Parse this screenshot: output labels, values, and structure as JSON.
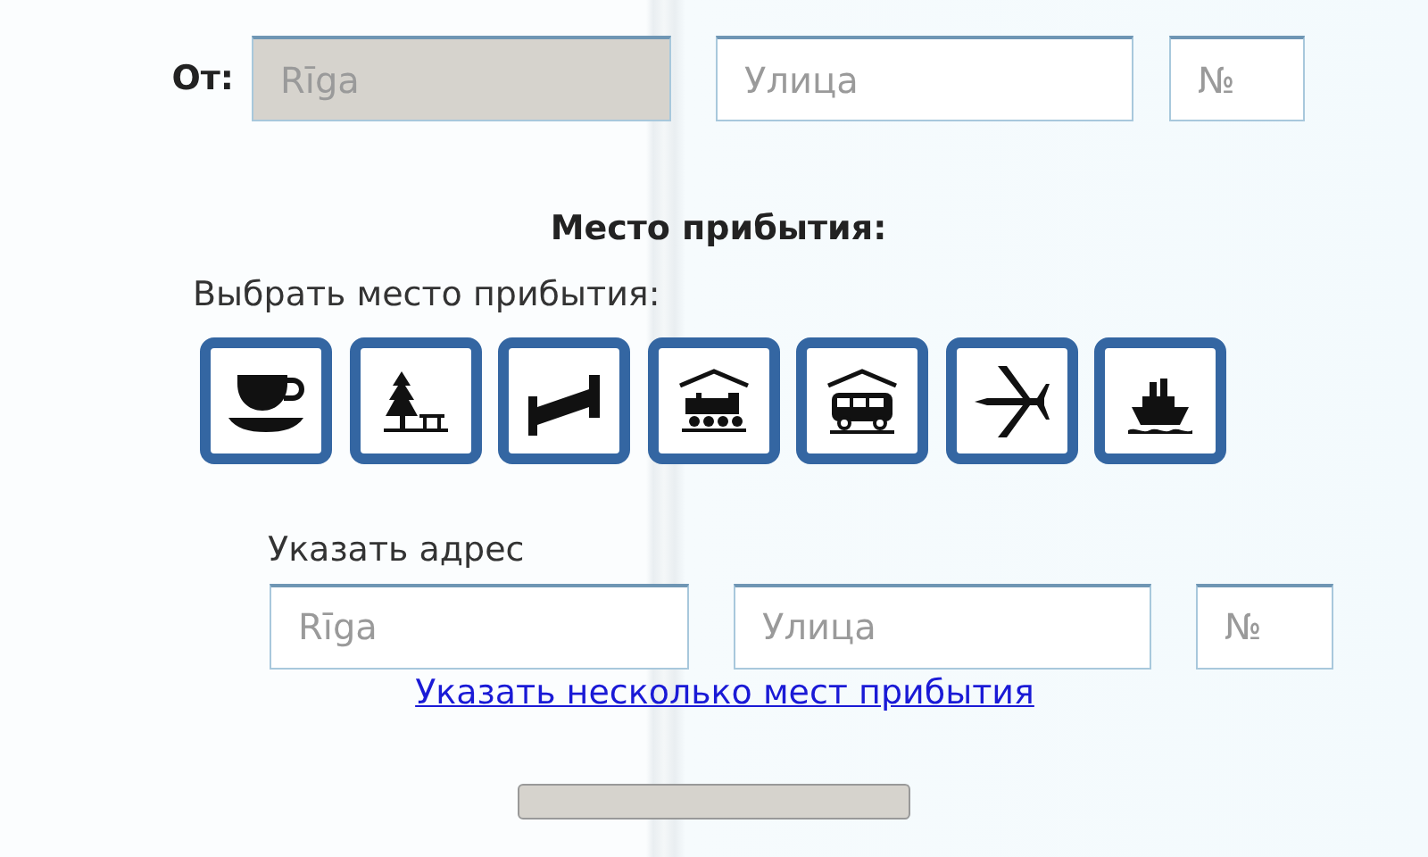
{
  "from": {
    "label": "От:",
    "fields": [
      {
        "kind": "city",
        "value": "Rīga",
        "disabled": true
      },
      {
        "kind": "street",
        "placeholder": "Улица",
        "disabled": false
      },
      {
        "kind": "number",
        "placeholder": "№",
        "disabled": false
      }
    ]
  },
  "arrival": {
    "title": "Место прибытия:",
    "choose_label": "Выбрать место прибытия:",
    "places": [
      {
        "kind": "cafe"
      },
      {
        "kind": "park"
      },
      {
        "kind": "hotel"
      },
      {
        "kind": "train"
      },
      {
        "kind": "bus"
      },
      {
        "kind": "airport"
      },
      {
        "kind": "port"
      }
    ],
    "address_label": "Указать адрес",
    "fields": [
      {
        "kind": "city",
        "placeholder": "Rīga",
        "disabled": false
      },
      {
        "kind": "street",
        "placeholder": "Улица",
        "disabled": false
      },
      {
        "kind": "number",
        "placeholder": "№",
        "disabled": false
      }
    ],
    "link": "Указать несколько мест прибытия"
  }
}
